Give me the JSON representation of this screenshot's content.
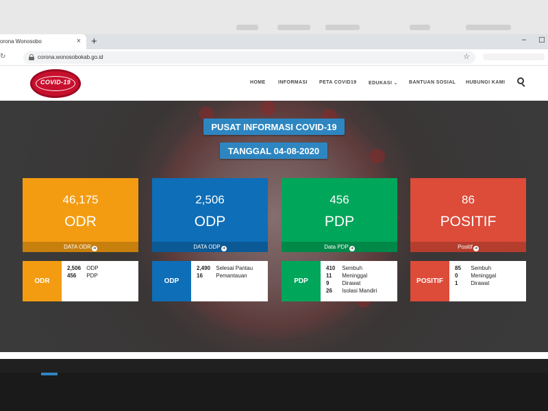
{
  "browser": {
    "tab_title": "orona Wonosobo",
    "tab_close": "×",
    "new_tab": "+",
    "minimize": "–",
    "maximize": "☐",
    "url": "corona.wonosobokab.go.id",
    "star": "☆",
    "reload": "↻"
  },
  "site": {
    "logo_text": "COVID-19",
    "nav": [
      "HOME",
      "INFORMASI",
      "PETA COVID19",
      "EDUKASI ⌄",
      "BANTUAN SOSIAL",
      "HUBUNGI KAMI"
    ]
  },
  "hero": {
    "title": "PUSAT INFORMASI COVID-19",
    "date": "TANGGAL 04-08-2020"
  },
  "cards": [
    {
      "value": "46,175",
      "label": "ODR",
      "link": "DATA ODR",
      "color": "#f39c12"
    },
    {
      "value": "2,506",
      "label": "ODP",
      "link": "DATA ODP",
      "color": "#0e6eb8"
    },
    {
      "value": "456",
      "label": "PDP",
      "link": "Data PDP",
      "color": "#00a65a"
    },
    {
      "value": "86",
      "label": "POSITIF",
      "link": "Positif",
      "color": "#dd4b39"
    }
  ],
  "details": [
    {
      "tag": "ODR",
      "rows": [
        {
          "n": "2,506",
          "t": "ODP"
        },
        {
          "n": "456",
          "t": "PDP"
        }
      ]
    },
    {
      "tag": "ODP",
      "rows": [
        {
          "n": "2,490",
          "t": "Selesai Pantau"
        },
        {
          "n": "16",
          "t": "Pemantauan"
        }
      ]
    },
    {
      "tag": "PDP",
      "rows": [
        {
          "n": "410",
          "t": "Sembuh"
        },
        {
          "n": "11",
          "t": "Meninggal"
        },
        {
          "n": "9",
          "t": "Dirawat"
        },
        {
          "n": "26",
          "t": "Isolasi Mandiri"
        }
      ]
    },
    {
      "tag": "POSITIF",
      "rows": [
        {
          "n": "85",
          "t": "Sembuh"
        },
        {
          "n": "0",
          "t": "Meninggal"
        },
        {
          "n": "1",
          "t": "Dirawat"
        }
      ]
    }
  ]
}
